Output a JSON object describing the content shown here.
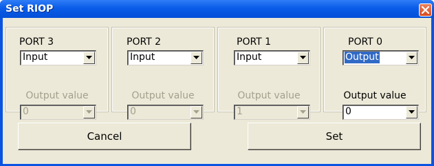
{
  "window": {
    "title": "Set RIOP"
  },
  "ports": [
    {
      "label": "PORT 3",
      "mode": "Input",
      "output_label": "Output value",
      "output_value": "0"
    },
    {
      "label": "PORT 2",
      "mode": "Input",
      "output_label": "Output value",
      "output_value": "0"
    },
    {
      "label": "PORT 1",
      "mode": "Input",
      "output_label": "Output value",
      "output_value": "1"
    },
    {
      "label": "PORT 0",
      "mode": "Output",
      "output_label": "Output value",
      "output_value": "0"
    }
  ],
  "buttons": {
    "cancel": "Cancel",
    "set": "Set"
  },
  "colors": {
    "titlebar": "#0a54e2",
    "face": "#ece9d8",
    "selection": "#316ac5"
  }
}
